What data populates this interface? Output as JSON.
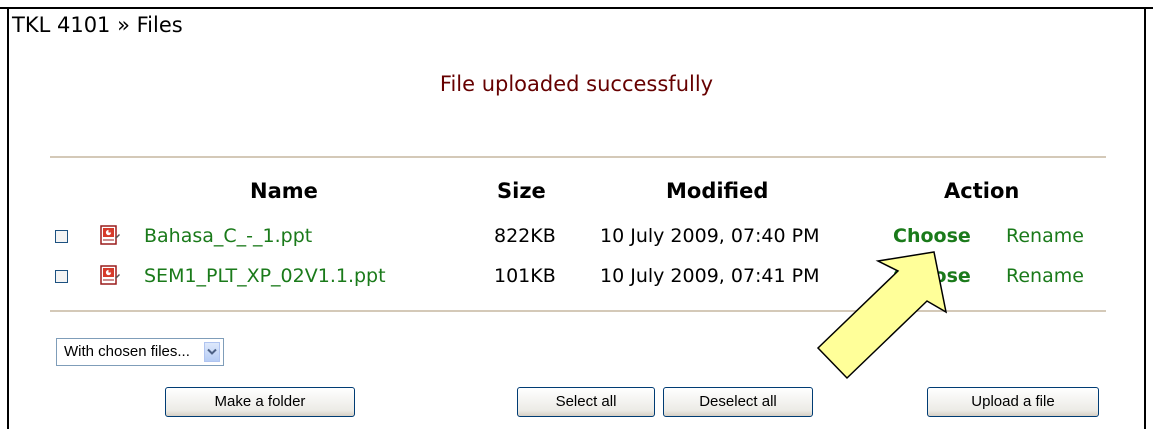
{
  "breadcrumb": "TKL 4101 » Files",
  "notice": "File uploaded successfully",
  "table": {
    "headers": {
      "name": "Name",
      "size": "Size",
      "modified": "Modified",
      "action": "Action"
    },
    "rows": [
      {
        "name": "Bahasa_C_-_1.ppt",
        "size": "822KB",
        "modified": "10 July 2009, 07:40 PM",
        "choose": "Choose",
        "rename": "Rename",
        "checked": false,
        "icon": "ppt-file-icon"
      },
      {
        "name": "SEM1_PLT_XP_02V1.1.ppt",
        "size": "101KB",
        "modified": "10 July 2009, 07:41 PM",
        "choose": "Choose",
        "rename": "Rename",
        "checked": false,
        "icon": "ppt-file-icon"
      }
    ]
  },
  "chosen_files_select": {
    "selected": "With chosen files..."
  },
  "buttons": {
    "make_folder": "Make a folder",
    "select_all": "Select all",
    "deselect_all": "Deselect all",
    "upload_file": "Upload a file"
  },
  "annotation": {
    "icon": "pointer-arrow-icon",
    "color": "#ffff99",
    "points_to": "Choose"
  },
  "colors": {
    "link": "#1a7a1a",
    "notice": "#660000",
    "rule": "#d4c9b8"
  }
}
